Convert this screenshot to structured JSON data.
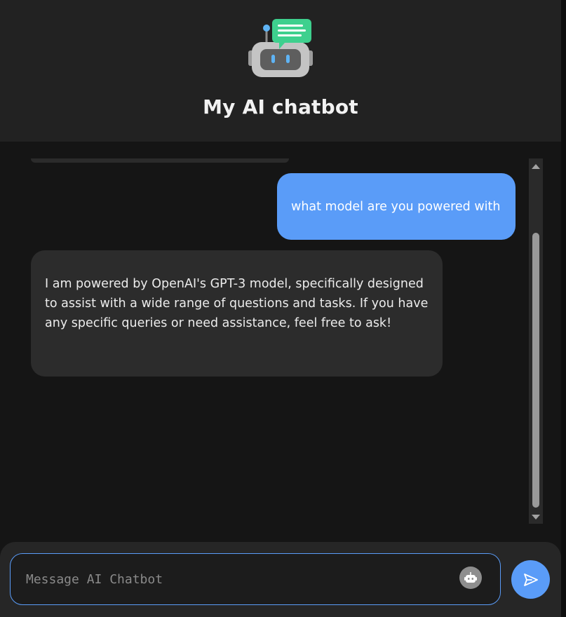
{
  "header": {
    "title": "My AI chatbot",
    "logo_icon": "robot-chat-icon"
  },
  "messages": [
    {
      "role": "user",
      "text": "what model are you powered with"
    },
    {
      "role": "bot",
      "text": "I am powered by OpenAI's GPT-3 model, specifically designed to assist with a wide range of questions and tasks. If you have any specific queries or need assistance, feel free to ask!"
    }
  ],
  "composer": {
    "placeholder": "Message AI Chatbot",
    "value": "",
    "bot_icon": "robot-icon",
    "send_icon": "send-icon"
  },
  "colors": {
    "accent": "#5a9cf8",
    "background": "#151515",
    "header": "#222222",
    "bot_bubble": "#2c2c2c"
  }
}
